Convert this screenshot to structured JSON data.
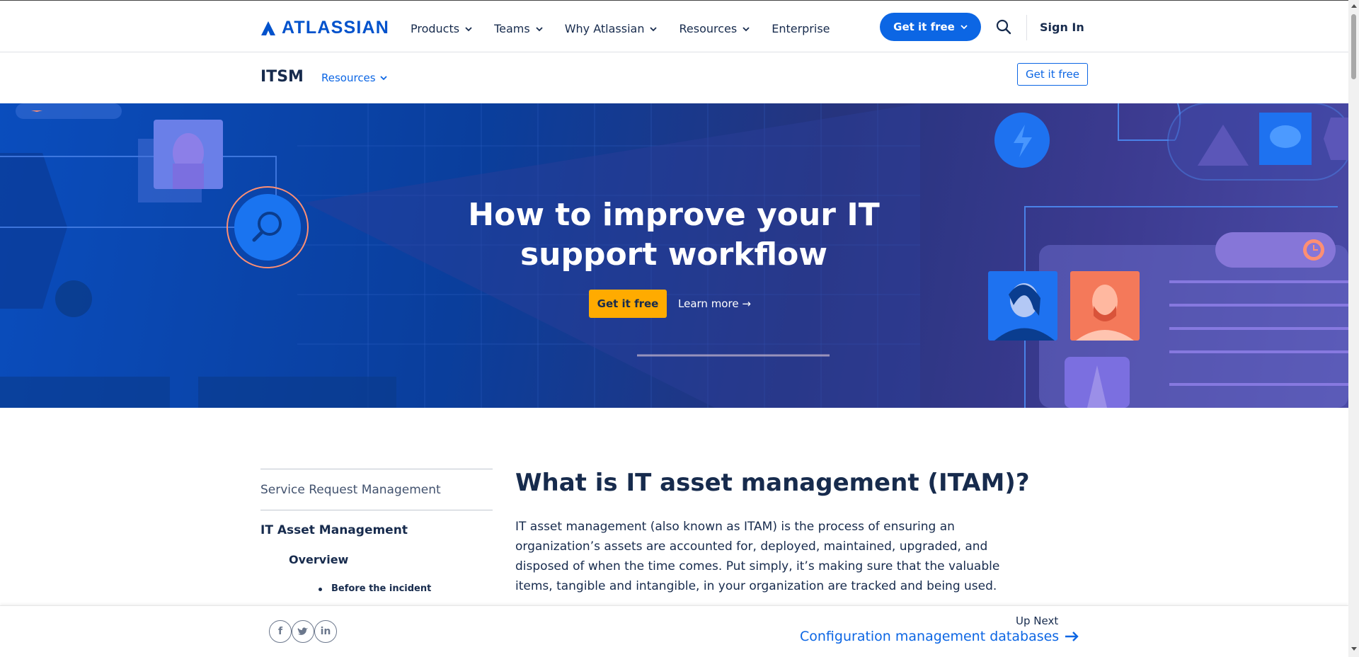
{
  "brand": {
    "name": "ATLASSIAN",
    "color": "#0052cc"
  },
  "nav": {
    "items": [
      {
        "label": "Products",
        "has_dropdown": true
      },
      {
        "label": "Teams",
        "has_dropdown": true
      },
      {
        "label": "Why Atlassian",
        "has_dropdown": true
      },
      {
        "label": "Resources",
        "has_dropdown": true
      },
      {
        "label": "Enterprise",
        "has_dropdown": false
      }
    ],
    "cta_label": "Get it free",
    "search_icon": "search-icon",
    "signin_label": "Sign In"
  },
  "subnav": {
    "title": "ITSM",
    "resources_label": "Resources",
    "cta_label": "Get it free"
  },
  "hero": {
    "title": "How to improve your IT support workflow",
    "cta_label": "Get it free",
    "learn_more_label": "Learn more →"
  },
  "sidebar": {
    "items": [
      {
        "label": "Service Request Management"
      },
      {
        "label": "IT Asset Management"
      }
    ],
    "sub_label": "Overview",
    "bullet_label": "Before the incident"
  },
  "article": {
    "title": "What is IT asset management (ITAM)?",
    "body": "IT asset management (also known as ITAM) is the process of ensuring an organization’s assets are accounted for, deployed, maintained, upgraded, and disposed of when the time comes. Put simply, it’s making sure that the valuable items, tangible and intangible, in your organization are tracked and being used."
  },
  "bottom": {
    "social": [
      {
        "icon": "facebook-icon",
        "glyph": "f"
      },
      {
        "icon": "twitter-icon",
        "glyph": "t"
      },
      {
        "icon": "linkedin-icon",
        "glyph": "in"
      }
    ],
    "up_next_label": "Up Next",
    "up_next_link": "Configuration management databases"
  },
  "colors": {
    "accent": "#0c66e4",
    "hero_cta": "#ffab00",
    "text": "#172b4d"
  }
}
